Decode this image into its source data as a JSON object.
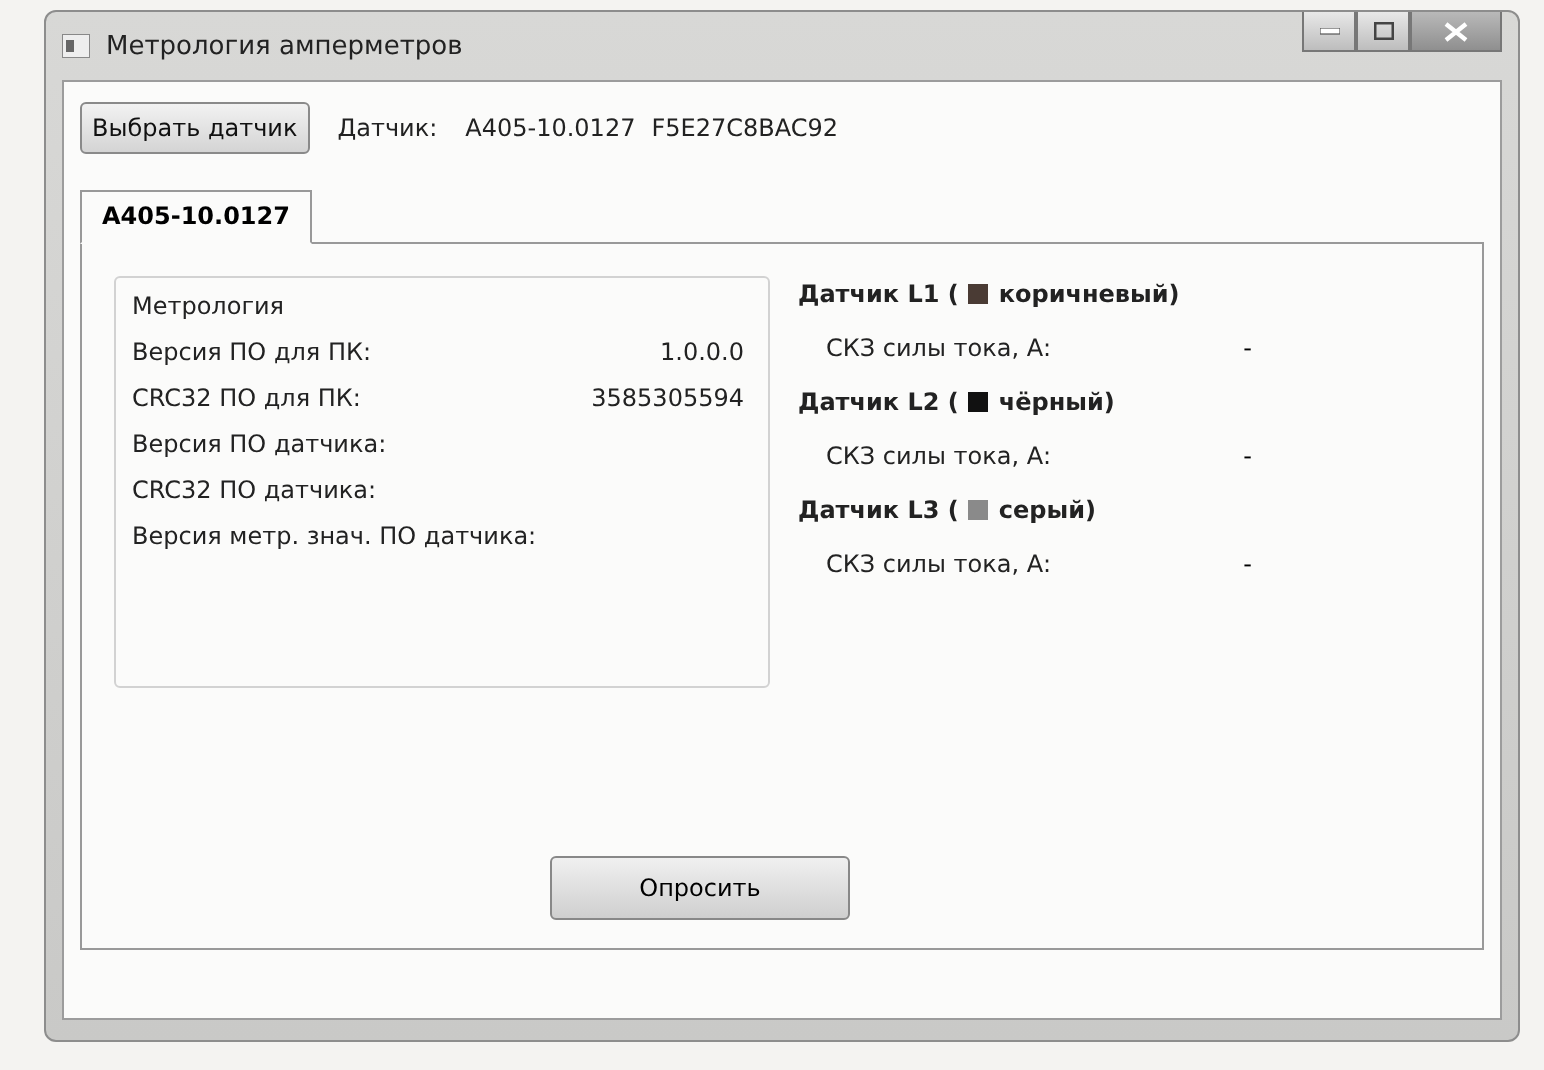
{
  "window": {
    "title": "Метрология амперметров"
  },
  "toolbar": {
    "button": "Выбрать датчик",
    "sensor_label": "Датчик:",
    "sensor_model": "A405-10.0127",
    "sensor_id": "F5E27C8BAC92"
  },
  "tabs": [
    {
      "label": "A405-10.0127",
      "selected": true
    }
  ],
  "metrology": {
    "title": "Метрология",
    "rows": [
      {
        "label": "Версия ПО для ПК:",
        "value": "1.0.0.0"
      },
      {
        "label": "CRC32 ПО для ПК:",
        "value": "3585305594"
      },
      {
        "label": "Версия ПО датчика:"
      },
      {
        "label": "CRC32 ПО датчика:"
      },
      {
        "label": "Версия метр. знач. ПО датчика:"
      }
    ]
  },
  "sensors": [
    {
      "title": "Датчик L1 (",
      "color": "#4a3b34",
      "color_name": "коричневый)",
      "reading_label": "СКЗ силы тока, А:",
      "reading": "-"
    },
    {
      "title": "Датчик L2 (",
      "color": "#111111",
      "color_name": "чёрный)",
      "reading_label": "СКЗ силы тока, А:",
      "reading": "-"
    },
    {
      "title": "Датчик L3 (",
      "color": "#8a8a8a",
      "color_name": "серый)",
      "reading_label": "СКЗ силы тока, А:",
      "reading": "-"
    }
  ],
  "query_button": "Опросить"
}
